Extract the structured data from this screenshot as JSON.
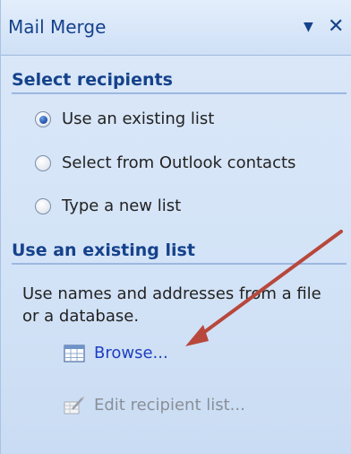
{
  "pane": {
    "title": "Mail Merge",
    "menu_icon": "dropdown-arrow-icon",
    "close_icon": "close-icon"
  },
  "select_recipients": {
    "heading": "Select recipients",
    "options": [
      {
        "label": "Use an existing list",
        "checked": true
      },
      {
        "label": "Select from Outlook contacts",
        "checked": false
      },
      {
        "label": "Type a new list",
        "checked": false
      }
    ]
  },
  "existing_list": {
    "heading": "Use an existing list",
    "description": "Use names and addresses from a file or a database.",
    "browse_label": "Browse...",
    "browse_icon": "table-icon",
    "edit_label": "Edit recipient list...",
    "edit_icon": "edit-list-icon"
  },
  "annotation": {
    "color": "#b8473c",
    "kind": "arrow"
  }
}
